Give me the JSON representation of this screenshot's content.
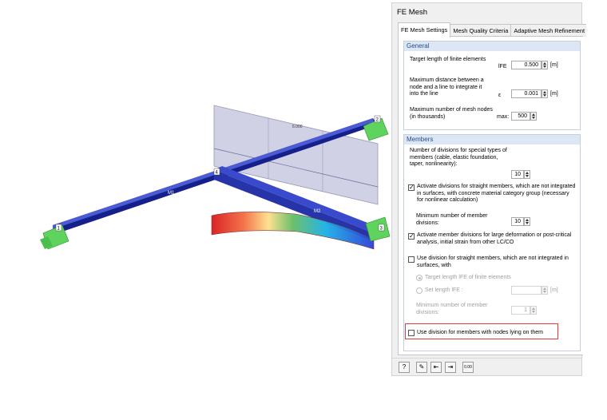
{
  "viewport": {
    "dim_label": "6.000",
    "nodes": [
      "1",
      "2",
      "3",
      "4"
    ],
    "members": [
      "M1",
      "M2"
    ]
  },
  "dialog": {
    "title": "FE Mesh",
    "tabs": [
      "FE Mesh Settings",
      "Mesh Quality Criteria",
      "Adaptive Mesh Refinement"
    ],
    "general": {
      "heading": "General",
      "target_label": "Target length of finite elements",
      "target_symbol": "lFE",
      "target_value": "0.500",
      "target_unit": "[m]",
      "maxdist_label": "Maximum distance between a node and a line to integrate it into the line",
      "maxdist_symbol": "ε",
      "maxdist_value": "0.001",
      "maxdist_unit": "[m]",
      "maxnodes_label": "Maximum number of mesh nodes (in thousands)",
      "maxnodes_symbol": "max:",
      "maxnodes_value": "500"
    },
    "members": {
      "heading": "Members",
      "divisions_label": "Number of divisions for special types of members (cable, elastic foundation, taper, nonlinearity):",
      "divisions_value": "10",
      "straight_label": "Activate divisions for straight members, which are not integrated in surfaces, with concrete material category group (necessary for nonlinear calculation)",
      "straight_checked": true,
      "min_div_label": "Minimum number of member divisions:",
      "min_div_value": "10",
      "large_def_label": "Activate member divisions for large deformation or post-critical analysis, initial strain from other LC/CO",
      "large_def_checked": true,
      "use_div_label": "Use division for straight members, which are not integrated in surfaces, with",
      "use_div_checked": false,
      "radio_target_label": "Target length lFE of finite elements",
      "radio_set_label": "Set length lFE :",
      "set_len_unit": "[m]",
      "min_div2_label": "Minimum number of member divisions:",
      "min_div2_value": "1",
      "nodes_on_label": "Use division for members with nodes lying on them",
      "nodes_on_checked": false
    },
    "toolbar": [
      "help-icon",
      "edit-icon",
      "import-icon",
      "export-icon",
      "calculator-icon"
    ],
    "toolbar_calc_text": "0.00"
  }
}
